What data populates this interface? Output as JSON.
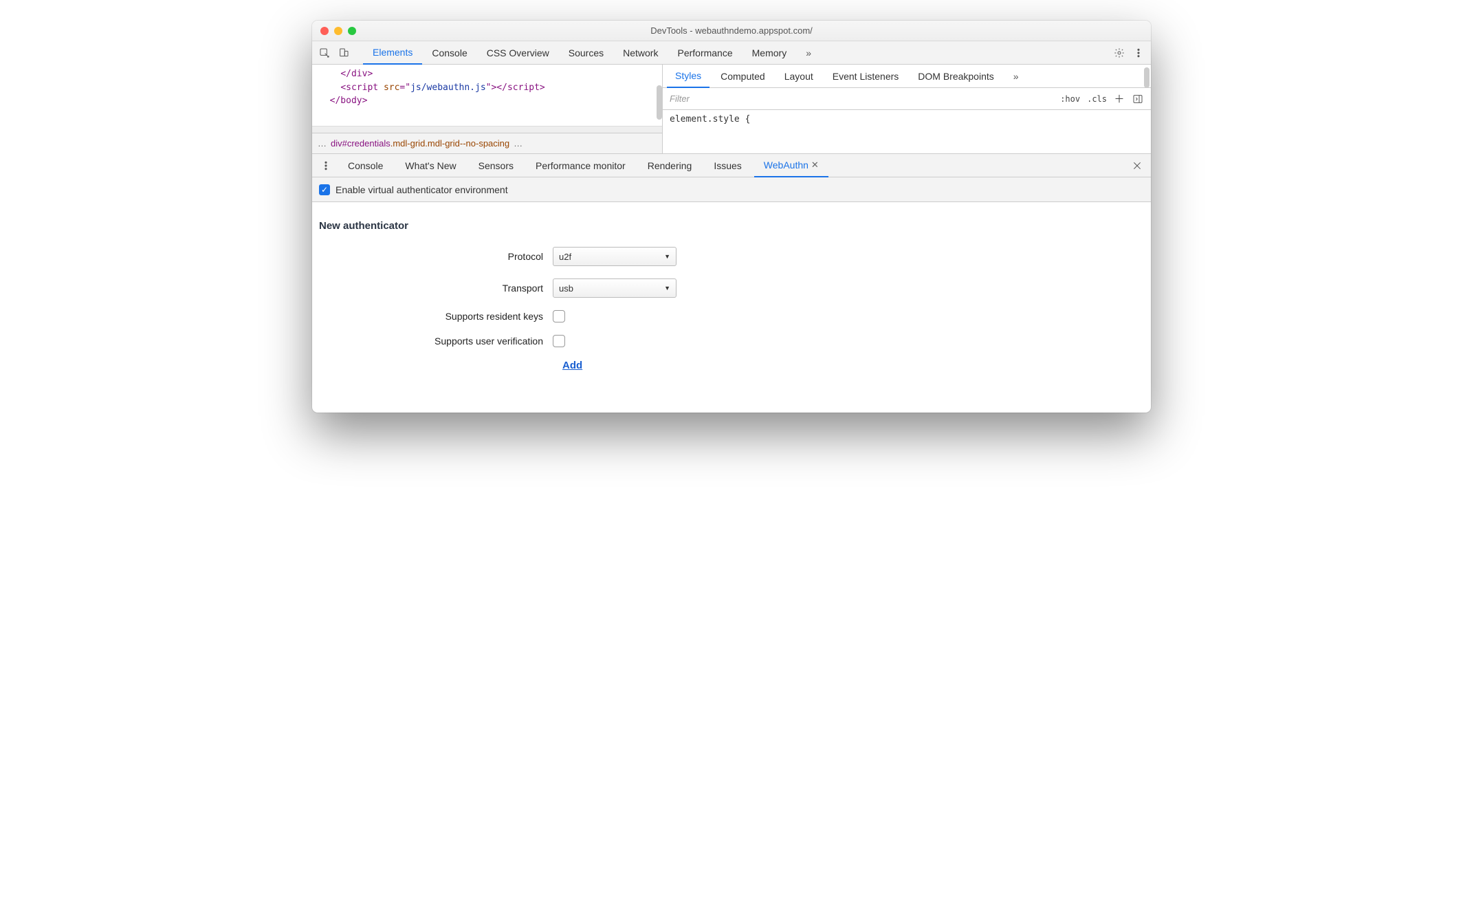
{
  "window": {
    "title": "DevTools - webauthndemo.appspot.com/"
  },
  "main_tabs": {
    "items": [
      "Elements",
      "Console",
      "CSS Overview",
      "Sources",
      "Network",
      "Performance",
      "Memory"
    ],
    "active": 0,
    "overflow": "»"
  },
  "code": {
    "line1_tag": "</div>",
    "line2_open": "<script ",
    "line2_attr": "src",
    "line2_eq": "=\"",
    "line2_val": "js/webauthn.js",
    "line2_close": "\"></scr",
    "line2_close2": "ipt>",
    "line3": "</body>"
  },
  "breadcrumb": {
    "pre": "…",
    "tag": "div",
    "id": "#credentials",
    "cls": ".mdl-grid.mdl-grid--no-spacing",
    "post": "…"
  },
  "styles": {
    "tabs": [
      "Styles",
      "Computed",
      "Layout",
      "Event Listeners",
      "DOM Breakpoints"
    ],
    "overflow": "»",
    "filter_placeholder": "Filter",
    "hov": ":hov",
    "cls": ".cls",
    "body": "element.style {"
  },
  "drawer": {
    "tabs": [
      "Console",
      "What's New",
      "Sensors",
      "Performance monitor",
      "Rendering",
      "Issues",
      "WebAuthn"
    ],
    "active": 6
  },
  "webauthn": {
    "enable_label": "Enable virtual authenticator environment",
    "section_title": "New authenticator",
    "rows": {
      "protocol_label": "Protocol",
      "protocol_value": "u2f",
      "transport_label": "Transport",
      "transport_value": "usb",
      "resident_label": "Supports resident keys",
      "userverif_label": "Supports user verification"
    },
    "add": "Add"
  }
}
